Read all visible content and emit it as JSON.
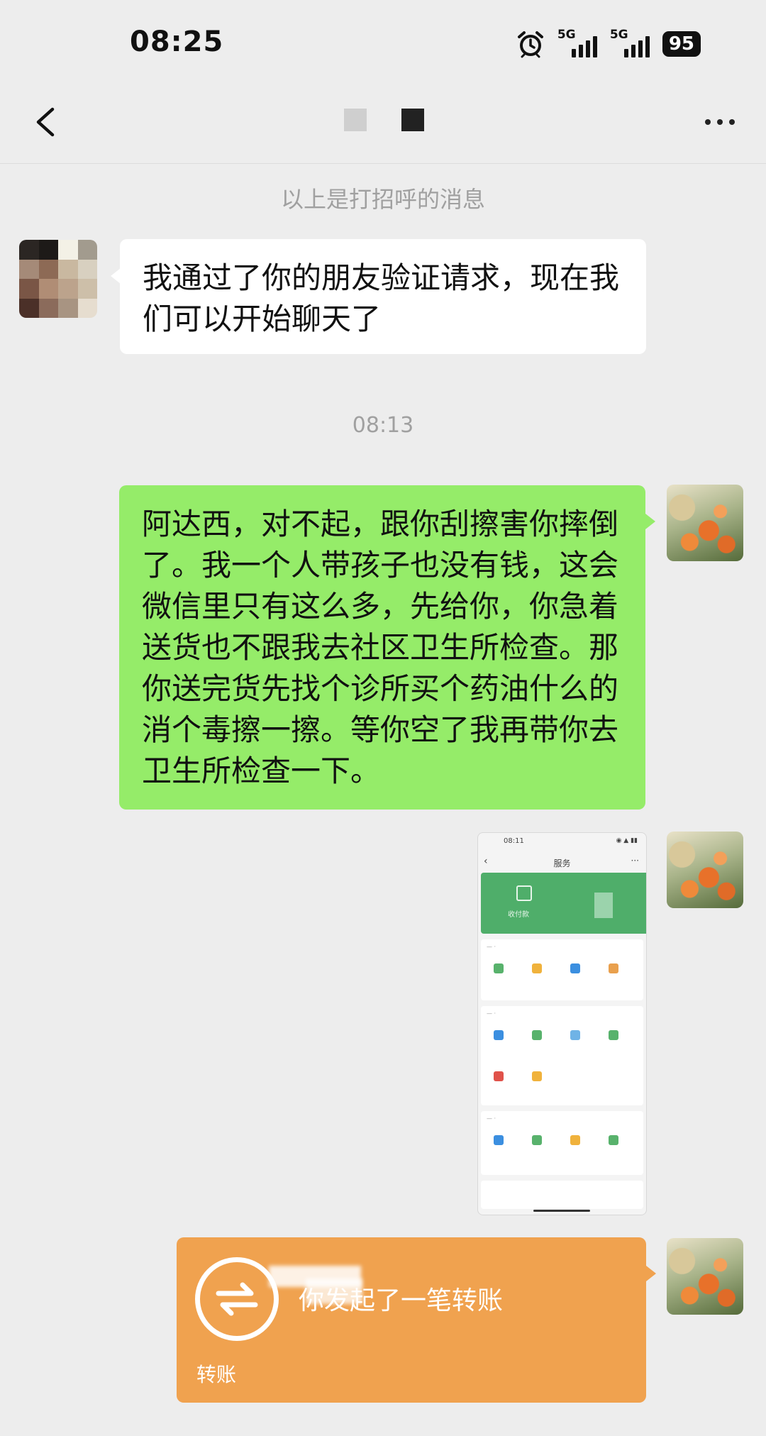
{
  "status_bar": {
    "time": "08:25",
    "network_1": "5G",
    "network_2": "5G",
    "battery": "95"
  },
  "nav": {
    "back_icon": "chevron-left-icon",
    "more_icon": "more-dots-icon"
  },
  "chat": {
    "greeting_notice": "以上是打招呼的消息",
    "friend_message": "我通过了你的朋友验证请求，现在我们可以开始聊天了",
    "timestamp": "08:13",
    "my_message": "阿达西，对不起，跟你刮擦害你摔倒了。我一个人带孩子也没有钱，这会微信里只有这么多，先给你，你急着送货也不跟我去社区卫生所检查。那你送完货先找个诊所买个药油什么的消个毒擦一擦。等你空了我再带你去卫生所检查一下。",
    "screenshot": {
      "time": "08:11",
      "title": "服务",
      "card_label": "收付款"
    },
    "transfer": {
      "text": "你发起了一笔转账",
      "label": "转账"
    }
  },
  "colors": {
    "background": "#ededed",
    "my_bubble": "#95ec69",
    "friend_bubble": "#ffffff",
    "transfer_card": "#f0a24f",
    "system_text": "#a0a0a0"
  }
}
